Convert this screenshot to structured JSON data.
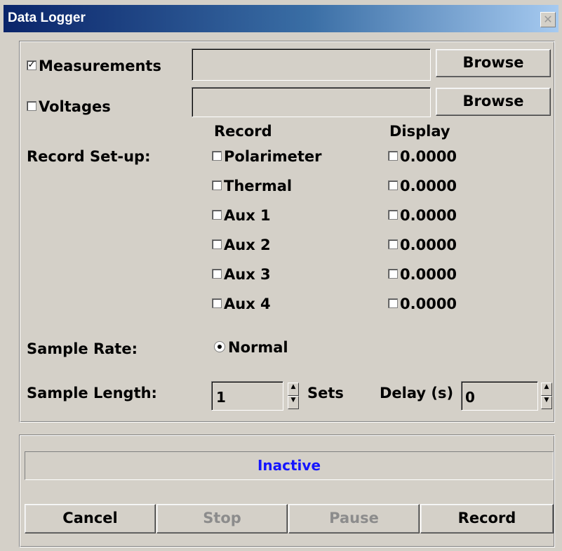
{
  "window": {
    "title": "Data Logger",
    "close_glyph": "✕"
  },
  "files": {
    "measurements": {
      "label": "Measurements",
      "checked": true,
      "path": "",
      "browse_label": "Browse"
    },
    "voltages": {
      "label": "Voltages",
      "checked": false,
      "path": "",
      "browse_label": "Browse"
    }
  },
  "record_setup": {
    "label": "Record Set-up:",
    "record_header": "Record",
    "display_header": "Display",
    "channels": [
      {
        "name": "Polarimeter",
        "record": false,
        "display": false,
        "value": "0.0000"
      },
      {
        "name": "Thermal",
        "record": false,
        "display": false,
        "value": "0.0000"
      },
      {
        "name": "Aux 1",
        "record": false,
        "display": false,
        "value": "0.0000"
      },
      {
        "name": "Aux 2",
        "record": false,
        "display": false,
        "value": "0.0000"
      },
      {
        "name": "Aux 3",
        "record": false,
        "display": false,
        "value": "0.0000"
      },
      {
        "name": "Aux 4",
        "record": false,
        "display": false,
        "value": "0.0000"
      }
    ]
  },
  "sample_rate": {
    "label": "Sample Rate:",
    "option": "Normal",
    "selected": true
  },
  "sample_length": {
    "label": "Sample Length:",
    "value": "1",
    "unit": "Sets",
    "delay_label": "Delay (s)",
    "delay_value": "0"
  },
  "status": {
    "text": "Inactive"
  },
  "buttons": {
    "cancel": "Cancel",
    "stop": "Stop",
    "pause": "Pause",
    "record": "Record"
  }
}
